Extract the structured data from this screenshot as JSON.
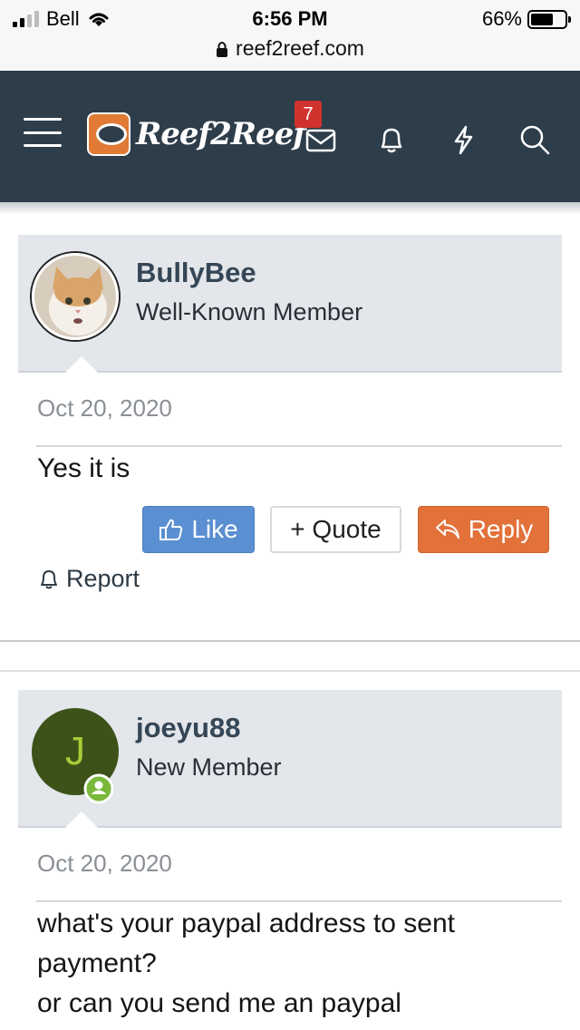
{
  "status_bar": {
    "carrier": "Bell",
    "time": "6:56 PM",
    "battery_percent": "66%",
    "battery_level": 0.66
  },
  "browser": {
    "url": "reef2reef.com"
  },
  "header": {
    "logo_text": "Reef2Reef",
    "inbox_count": "7"
  },
  "posts": [
    {
      "username": "BullyBee",
      "role": "Well-Known Member",
      "date": "Oct 20, 2020",
      "body": "Yes it is",
      "actions": {
        "like": "Like",
        "quote": "+ Quote",
        "reply": "Reply",
        "report": "Report"
      }
    },
    {
      "username": "joeyu88",
      "role": "New Member",
      "avatar_letter": "J",
      "date": "Oct 20, 2020",
      "body_lines": [
        "what's your paypal address to sent",
        "payment?",
        "or can you send me an paypal"
      ]
    }
  ],
  "colors": {
    "header_bg": "#2e3d4a",
    "panel_bg": "#e3e6ea",
    "like_bg": "#5a8fd1",
    "reply_bg": "#e2713a",
    "badge_bg": "#d0332e",
    "avatar_j_bg": "#3c5219",
    "avatar_j_letter": "#a9cc3a",
    "online_dot": "#79b83a"
  },
  "icons": [
    "signal-icon",
    "wifi-icon",
    "battery-icon",
    "lock-icon",
    "menu-icon",
    "mail-icon",
    "bell-icon",
    "bolt-icon",
    "search-icon",
    "thumbs-up-icon",
    "reply-arrow-icon",
    "report-bell-icon",
    "online-status-icon"
  ]
}
